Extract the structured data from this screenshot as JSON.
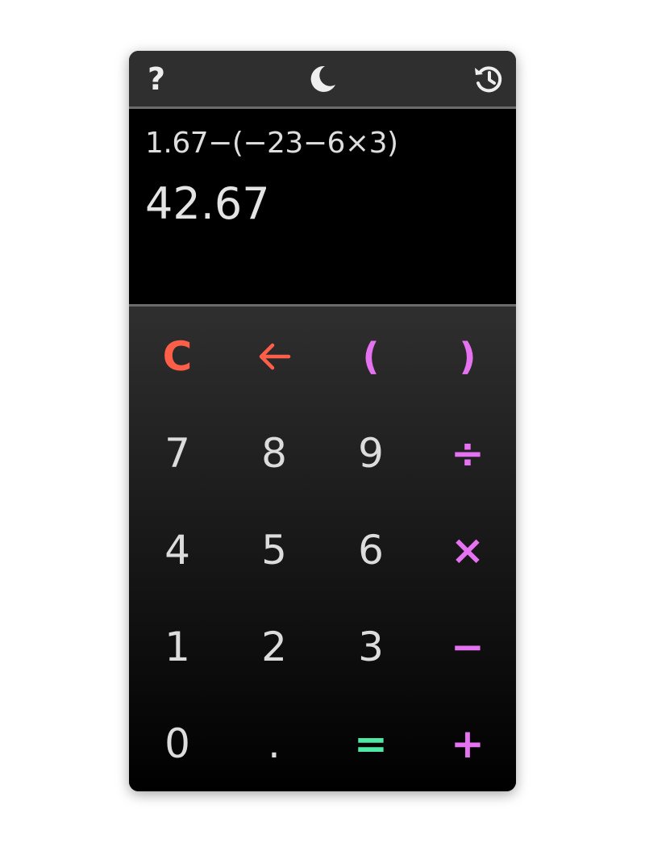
{
  "topbar": {
    "help_label": "?",
    "icons": [
      "help-icon",
      "moon-icon",
      "history-icon"
    ]
  },
  "display": {
    "expression": "1.67−(−23−6×3)",
    "result": "42.67"
  },
  "keys": {
    "clear": "C",
    "backspace": "←",
    "open_paren": "(",
    "close_paren": ")",
    "seven": "7",
    "eight": "8",
    "nine": "9",
    "divide": "÷",
    "four": "4",
    "five": "5",
    "six": "6",
    "multiply": "×",
    "one": "1",
    "two": "2",
    "three": "3",
    "minus": "−",
    "zero": "0",
    "decimal": ".",
    "equals": "=",
    "plus": "+"
  },
  "colors": {
    "danger": "#ff5e48",
    "operator": "#e573f1",
    "equals": "#4fe9a6",
    "digit": "#dcdcdc"
  }
}
